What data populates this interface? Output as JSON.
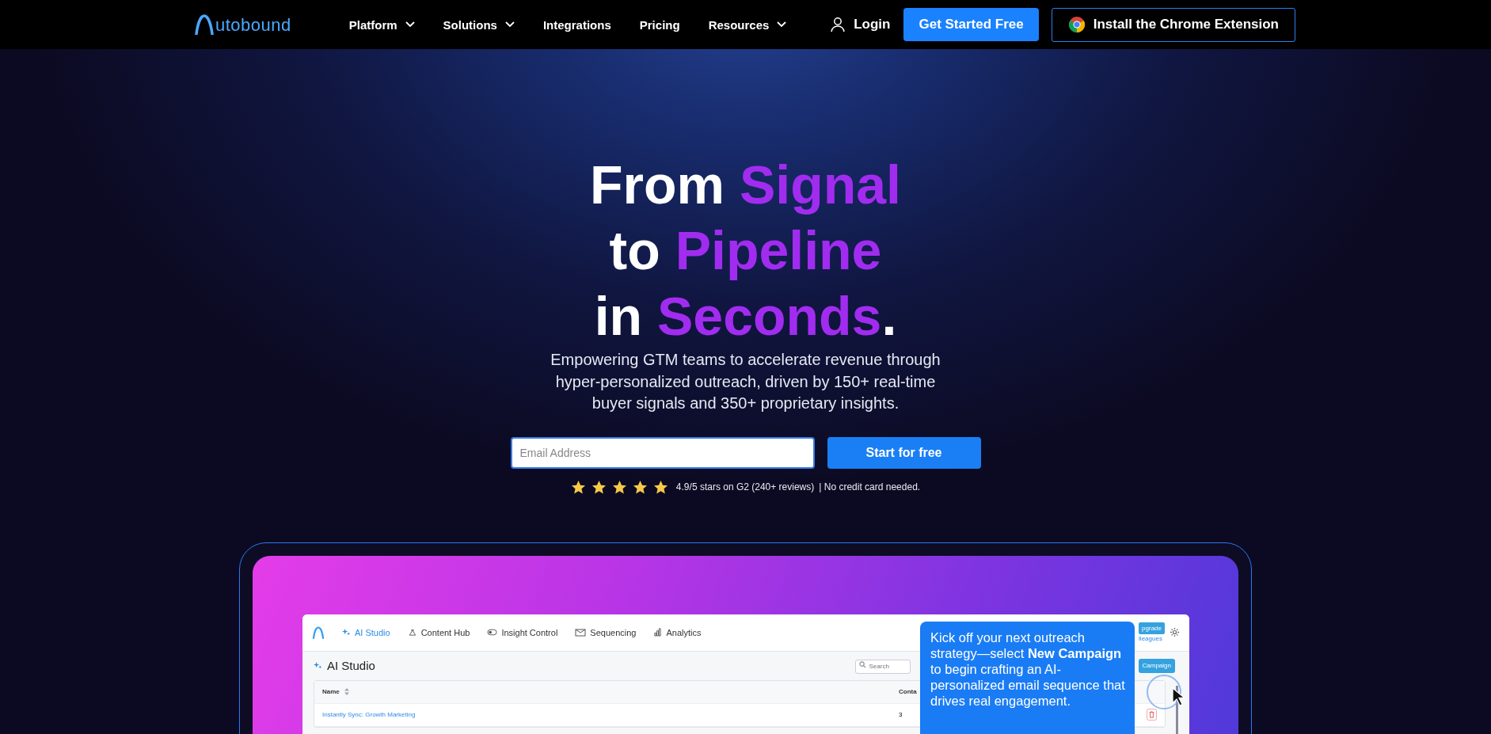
{
  "nav": {
    "logo_text": "utobound",
    "links": [
      {
        "label": "Platform",
        "has_menu": true
      },
      {
        "label": "Solutions",
        "has_menu": true
      },
      {
        "label": "Integrations",
        "has_menu": false
      },
      {
        "label": "Pricing",
        "has_menu": false
      },
      {
        "label": "Resources",
        "has_menu": true
      }
    ],
    "login": "Login",
    "cta": "Get Started Free",
    "extension": "Install the Chrome Extension"
  },
  "hero": {
    "headline": [
      [
        {
          "text": "From ",
          "accent": false
        },
        {
          "text": "Signal",
          "accent": true
        }
      ],
      [
        {
          "text": "to ",
          "accent": false
        },
        {
          "text": "Pipeline",
          "accent": true
        }
      ],
      [
        {
          "text": "in ",
          "accent": false
        },
        {
          "text": "Seconds",
          "accent": true
        },
        {
          "text": ".",
          "accent": false
        }
      ]
    ],
    "subtitle": "Empowering GTM teams to accelerate revenue through hyper-personalized outreach, driven by 150+ real-time buyer signals and 350+ proprietary insights.",
    "signup": {
      "placeholder": "Email Address",
      "button": "Start for free"
    },
    "rating": {
      "stars": 5,
      "text": "4.9/5 stars on G2 (240+ reviews)",
      "note": "| No credit card needed."
    }
  },
  "app": {
    "tabs": [
      {
        "label": "AI Studio",
        "selected": true
      },
      {
        "label": "Content Hub",
        "selected": false
      },
      {
        "label": "Insight Control",
        "selected": false
      },
      {
        "label": "Sequencing",
        "selected": false
      },
      {
        "label": "Analytics",
        "selected": false
      }
    ],
    "upgrade": "pgrade",
    "colleagues": "lleagues",
    "page_title": "AI Studio",
    "search": {
      "placeholder": "Search"
    },
    "new_campaign": "Campaign",
    "columns": [
      "Name",
      "Conta"
    ],
    "rows": [
      {
        "name": "Instantly Sync: Growth Marketing",
        "column_2": "3"
      }
    ]
  },
  "tooltip": "Kick off your next outreach strategy—select **New Campaign** to begin crafting an AI-personalized email sequence that drives real engagement."
}
